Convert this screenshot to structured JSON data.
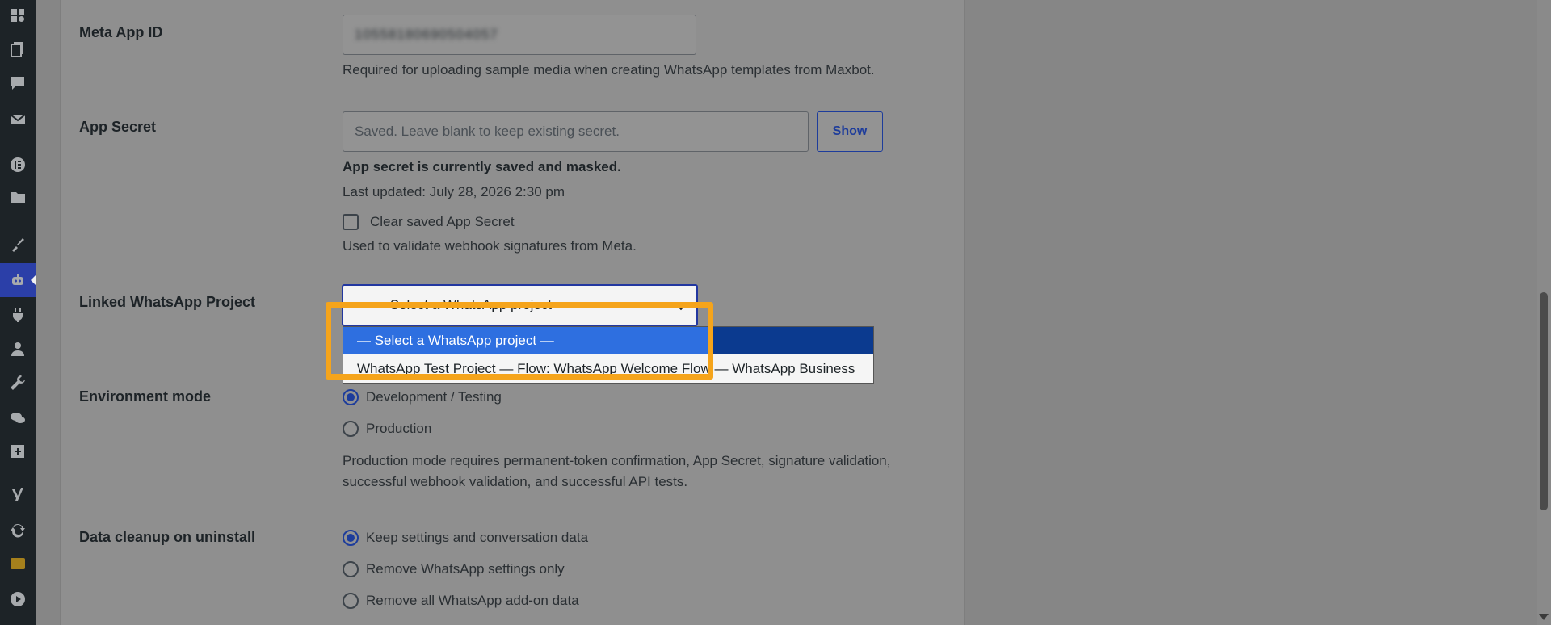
{
  "sidebar": {
    "icons": [
      "tools-icon",
      "pages-icon",
      "comments-icon",
      "mail-icon",
      "elementor-icon",
      "folder-icon",
      "paint-brush-icon",
      "bot-icon",
      "plugins-icon",
      "users-icon",
      "wrench-icon",
      "chat-bubbles-icon",
      "import-icon",
      "yoast-icon",
      "sync-icon",
      "badge-icon",
      "play-icon"
    ]
  },
  "form": {
    "meta_app_id": {
      "label": "Meta App ID",
      "value": "10558180690504057",
      "help": "Required for uploading sample media when creating WhatsApp templates from Maxbot."
    },
    "app_secret": {
      "label": "App Secret",
      "placeholder": "Saved. Leave blank to keep existing secret.",
      "show_label": "Show",
      "status": "App secret is currently saved and masked.",
      "last_updated": "Last updated: July 28, 2026 2:30 pm",
      "clear_label": "Clear saved App Secret",
      "help": "Used to validate webhook signatures from Meta."
    },
    "linked_project": {
      "label": "Linked WhatsApp Project",
      "selected": "— Select a WhatsApp project —",
      "options": [
        "— Select a WhatsApp project —",
        "WhatsApp Test Project — Flow: WhatsApp Welcome Flow — WhatsApp Business"
      ]
    },
    "environment": {
      "label": "Environment mode",
      "options": [
        "Development / Testing",
        "Production"
      ],
      "selected_index": 0,
      "help_line1": "Production mode requires permanent-token confirmation, App Secret, signature validation,",
      "help_line2": "successful webhook validation, and successful API tests."
    },
    "cleanup": {
      "label": "Data cleanup on uninstall",
      "options": [
        "Keep settings and conversation data",
        "Remove WhatsApp settings only",
        "Remove all WhatsApp add-on data"
      ],
      "selected_index": 0
    }
  },
  "colors": {
    "accent": "#2237a0",
    "highlight": "#f5a41b",
    "selected_option": "#2e6fe0"
  }
}
